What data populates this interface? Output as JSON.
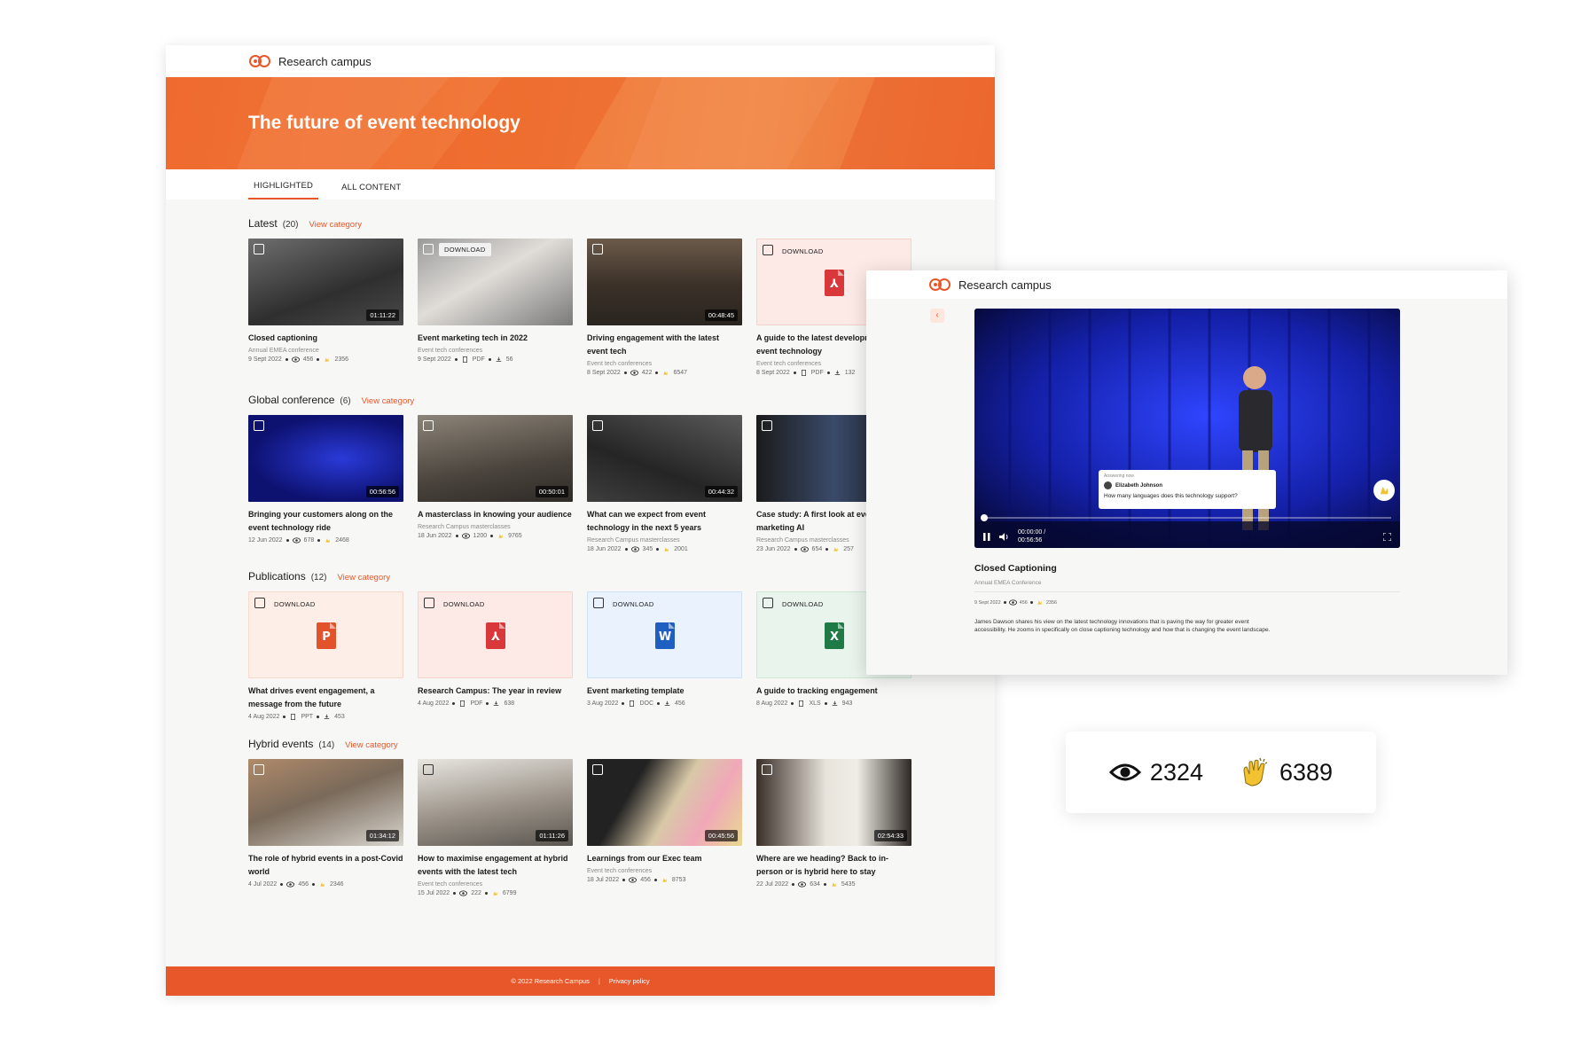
{
  "brand": "Research campus",
  "page_title": "The future of event technology",
  "tabs": [
    {
      "label": "HIGHLIGHTED"
    },
    {
      "label": "ALL CONTENT"
    }
  ],
  "sections": [
    {
      "title": "Latest",
      "count": "(20)",
      "link": "View category",
      "cards": [
        {
          "title": "Closed captioning",
          "subtitle": "Annual EMEA conference",
          "date": "9 Sept 2022",
          "m1": "456",
          "m2": "2356",
          "duration": "01:11:22"
        },
        {
          "title": "Event marketing tech in 2022",
          "subtitle": "Event tech conferences",
          "date": "9 Sept 2022",
          "m1": "PDF",
          "m2": "56",
          "download": "DOWNLOAD"
        },
        {
          "title": "Driving engagement with the latest event tech",
          "subtitle": "Event tech conferences",
          "date": "8 Sept 2022",
          "m1": "422",
          "m2": "6547",
          "duration": "00:48:45"
        },
        {
          "title": "A guide to the latest developments in event technology",
          "subtitle": "Event tech conferences",
          "date": "8 Sept 2022",
          "m1": "PDF",
          "m2": "132",
          "download": "DOWNLOAD"
        }
      ]
    },
    {
      "title": "Global conference",
      "count": "(6)",
      "link": "View category",
      "cards": [
        {
          "title": "Bringing your customers along on the event technology ride",
          "subtitle": "",
          "date": "12 Jun 2022",
          "m1": "678",
          "m2": "2468",
          "duration": "00:56:56"
        },
        {
          "title": "A masterclass in knowing your audience",
          "subtitle": "Research Campus masterclasses",
          "date": "18 Jun 2022",
          "m1": "1200",
          "m2": "9765",
          "duration": "00:50:01"
        },
        {
          "title": "What can we expect from event technology in the next 5 years",
          "subtitle": "Research Campus masterclasses",
          "date": "18 Jun 2022",
          "m1": "345",
          "m2": "2001",
          "duration": "00:44:32"
        },
        {
          "title": "Case study: A first look at event marketing AI",
          "subtitle": "Research Campus masterclasses",
          "date": "23 Jun 2022",
          "m1": "654",
          "m2": "257",
          "duration": ""
        }
      ]
    },
    {
      "title": "Publications",
      "count": "(12)",
      "link": "View category",
      "cards": [
        {
          "title": "What drives event engagement, a message from the future",
          "subtitle": "",
          "date": "4 Aug 2022",
          "m1": "PPT",
          "m2": "453",
          "download": "DOWNLOAD",
          "file": "P"
        },
        {
          "title": "Research Campus: The year in review",
          "subtitle": "",
          "date": "4 Aug 2022",
          "m1": "PDF",
          "m2": "638",
          "download": "DOWNLOAD",
          "file": "PDF"
        },
        {
          "title": "Event marketing template",
          "subtitle": "",
          "date": "3 Aug 2022",
          "m1": "DOC",
          "m2": "456",
          "download": "DOWNLOAD",
          "file": "W"
        },
        {
          "title": "A guide to tracking engagement",
          "subtitle": "",
          "date": "8 Aug 2022",
          "m1": "XLS",
          "m2": "943",
          "download": "DOWNLOAD",
          "file": "X"
        }
      ]
    },
    {
      "title": "Hybrid events",
      "count": "(14)",
      "link": "View category",
      "cards": [
        {
          "title": "The role of hybrid events in a post-Covid world",
          "subtitle": "",
          "date": "4 Jul 2022",
          "m1": "456",
          "m2": "2346",
          "duration": "01:34:12"
        },
        {
          "title": "How to maximise engagement at hybrid events with the latest tech",
          "subtitle": "Event tech conferences",
          "date": "15 Jul 2022",
          "m1": "222",
          "m2": "6799",
          "duration": "01:11:26"
        },
        {
          "title": "Learnings from our Exec team",
          "subtitle": "Event tech conferences",
          "date": "18 Jul 2022",
          "m1": "456",
          "m2": "8753",
          "duration": "00:45:56"
        },
        {
          "title": "Where are we heading? Back to in-person or is hybrid here to stay",
          "subtitle": "",
          "date": "22 Jul 2022",
          "m1": "634",
          "m2": "5435",
          "duration": "02:54:33"
        }
      ]
    }
  ],
  "footer": {
    "copyright": "© 2022 Research Campus",
    "separator": "|",
    "privacy": "Privacy policy"
  },
  "overlay": {
    "brand": "Research campus",
    "qa_label": "Answering now",
    "qa_user": "Elizabeth Johnson",
    "qa_question": "How many languages does this technology support?",
    "time_current": "00:00:00 /",
    "time_total": "00:56:56",
    "title": "Closed Captioning",
    "subtitle": "Annual EMEA Conference",
    "date": "9 Sept 2022",
    "views": "456",
    "claps": "2356",
    "description": "James Dawson shares his view on the latest technology innovations that is paving the way for greater event accessibility. He zooms in specifically on close captioning technology and how that is changing the event landscape."
  },
  "stats": {
    "views": "2324",
    "claps": "6389"
  },
  "colors": {
    "accent": "#e8572a",
    "banner": "#ef6a2e",
    "clap": "#f2c230"
  }
}
